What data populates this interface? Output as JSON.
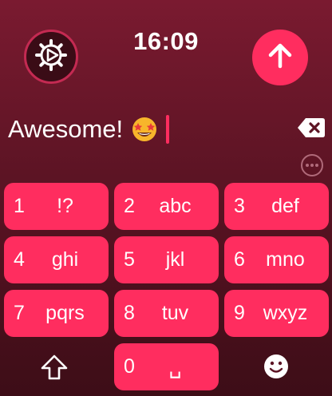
{
  "header": {
    "time": "16:09",
    "settings_icon": "gear-play-icon",
    "send_icon": "arrow-up-icon"
  },
  "input": {
    "text": "Awesome!",
    "emoji": "star-struck-emoji"
  },
  "keypad": {
    "keys": [
      {
        "digit": "1",
        "letters": "!?"
      },
      {
        "digit": "2",
        "letters": "abc"
      },
      {
        "digit": "3",
        "letters": "def"
      },
      {
        "digit": "4",
        "letters": "ghi"
      },
      {
        "digit": "5",
        "letters": "jkl"
      },
      {
        "digit": "6",
        "letters": "mno"
      },
      {
        "digit": "7",
        "letters": "pqrs"
      },
      {
        "digit": "8",
        "letters": "tuv"
      },
      {
        "digit": "9",
        "letters": "wxyz"
      },
      {
        "digit": "0",
        "letters": "␣"
      }
    ]
  },
  "colors": {
    "accent": "#ff2d5f",
    "background_top": "#7a1a30",
    "background_bottom": "#3d0d17"
  }
}
